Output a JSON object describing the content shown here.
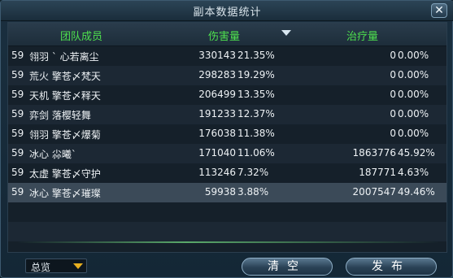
{
  "window": {
    "title": "副本数据统计",
    "close_label": "✕"
  },
  "table": {
    "headers": {
      "member": "团队成员",
      "damage": "伤害量",
      "healing": "治疗量"
    },
    "rows": [
      {
        "level": "59",
        "name": "翎羽 ` 心若离尘",
        "damage": "330143",
        "damage_pct": "21.35%",
        "heal": "0",
        "heal_pct": "0.00%"
      },
      {
        "level": "59",
        "name": "荒火 擎苍〆梵天",
        "damage": "298283",
        "damage_pct": "19.29%",
        "heal": "0",
        "heal_pct": "0.00%"
      },
      {
        "level": "59",
        "name": "天机 擎苍〆释天",
        "damage": "206499",
        "damage_pct": "13.35%",
        "heal": "0",
        "heal_pct": "0.00%"
      },
      {
        "level": "59",
        "name": "弈剑 落樱轻舞",
        "damage": "191233",
        "damage_pct": "12.37%",
        "heal": "0",
        "heal_pct": "0.00%"
      },
      {
        "level": "59",
        "name": "翎羽 擎苍〆爆菊",
        "damage": "176038",
        "damage_pct": "11.38%",
        "heal": "0",
        "heal_pct": "0.00%"
      },
      {
        "level": "59",
        "name": "冰心 尛曦`",
        "damage": "171040",
        "damage_pct": "11.06%",
        "heal": "1863776",
        "heal_pct": "45.92%"
      },
      {
        "level": "59",
        "name": "太虚 擎苍〆守护",
        "damage": "113246",
        "damage_pct": "7.32%",
        "heal": "187771",
        "heal_pct": "4.63%"
      },
      {
        "level": "59",
        "name": "冰心 擎苍〆璀璨",
        "damage": "59938",
        "damage_pct": "3.88%",
        "heal": "2007547",
        "heal_pct": "49.46%"
      }
    ]
  },
  "footer": {
    "filter_selected": "总览",
    "clear_label": "清空",
    "publish_label": "发布"
  }
}
